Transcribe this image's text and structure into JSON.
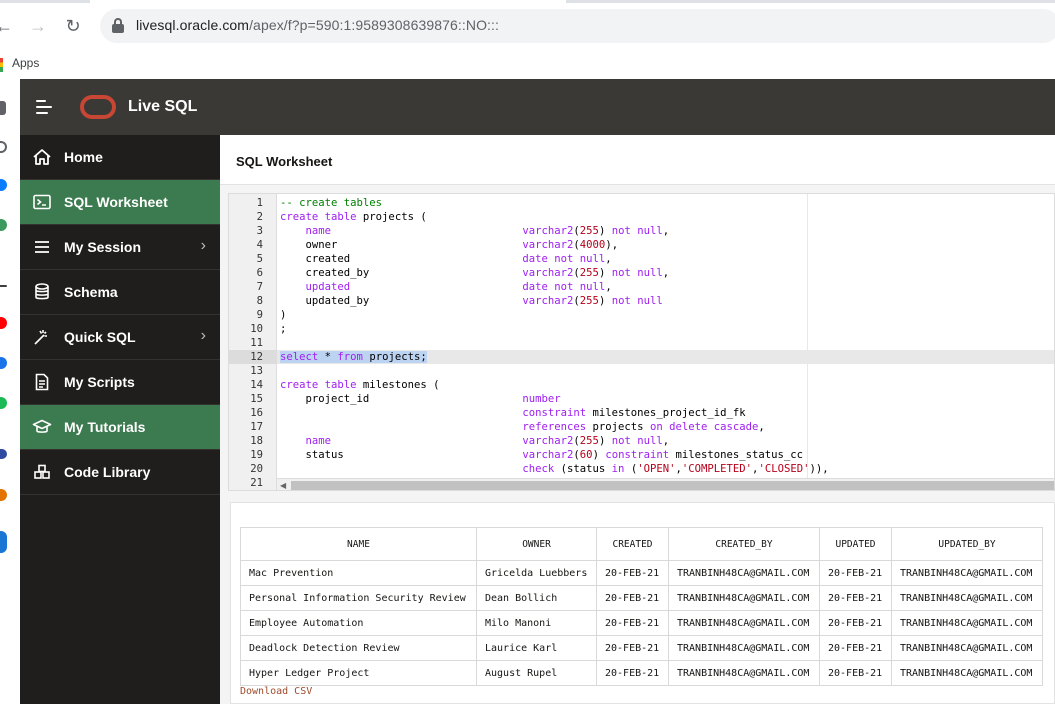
{
  "browser": {
    "url_host": "livesql.oracle.com",
    "url_path": "/apex/f?p=590:1:9589308639876::NO:::",
    "bookmark_apps": "Apps"
  },
  "header": {
    "title": "Live SQL",
    "brand_color": "#c74634"
  },
  "sidebar": {
    "items": [
      {
        "label": "Home",
        "icon": "home-icon",
        "active": false,
        "chevron": false
      },
      {
        "label": "SQL Worksheet",
        "icon": "terminal-icon",
        "active": true,
        "chevron": false
      },
      {
        "label": "My Session",
        "icon": "list-icon",
        "active": false,
        "chevron": true
      },
      {
        "label": "Schema",
        "icon": "database-icon",
        "active": false,
        "chevron": false
      },
      {
        "label": "Quick SQL",
        "icon": "magic-wand-icon",
        "active": false,
        "chevron": true
      },
      {
        "label": "My Scripts",
        "icon": "document-icon",
        "active": false,
        "chevron": false
      },
      {
        "label": "My Tutorials",
        "icon": "graduation-cap-icon",
        "active": true,
        "chevron": false
      },
      {
        "label": "Code Library",
        "icon": "building-blocks-icon",
        "active": false,
        "chevron": false
      }
    ],
    "active_color": "#3c7a4f"
  },
  "main": {
    "title": "SQL Worksheet",
    "editor": {
      "line_numbers": [
        "1",
        "2",
        "3",
        "4",
        "5",
        "6",
        "7",
        "8",
        "9",
        "10",
        "11",
        "12",
        "13",
        "14",
        "15",
        "16",
        "17",
        "18",
        "19",
        "20",
        "21"
      ],
      "highlighted_line": 12
    },
    "results": {
      "columns": [
        "NAME",
        "OWNER",
        "CREATED",
        "CREATED_BY",
        "UPDATED",
        "UPDATED_BY"
      ],
      "rows": [
        [
          "Mac Prevention",
          "Gricelda Luebbers",
          "20-FEB-21",
          "TRANBINH48CA@GMAIL.COM",
          "20-FEB-21",
          "TRANBINH48CA@GMAIL.COM"
        ],
        [
          "Personal Information Security Review",
          "Dean Bollich",
          "20-FEB-21",
          "TRANBINH48CA@GMAIL.COM",
          "20-FEB-21",
          "TRANBINH48CA@GMAIL.COM"
        ],
        [
          "Employee Automation",
          "Milo Manoni",
          "20-FEB-21",
          "TRANBINH48CA@GMAIL.COM",
          "20-FEB-21",
          "TRANBINH48CA@GMAIL.COM"
        ],
        [
          "Deadlock Detection Review",
          "Laurice Karl",
          "20-FEB-21",
          "TRANBINH48CA@GMAIL.COM",
          "20-FEB-21",
          "TRANBINH48CA@GMAIL.COM"
        ],
        [
          "Hyper Ledger Project",
          "August Rupel",
          "20-FEB-21",
          "TRANBINH48CA@GMAIL.COM",
          "20-FEB-21",
          "TRANBINH48CA@GMAIL.COM"
        ]
      ],
      "download_label": "Download CSV"
    }
  }
}
